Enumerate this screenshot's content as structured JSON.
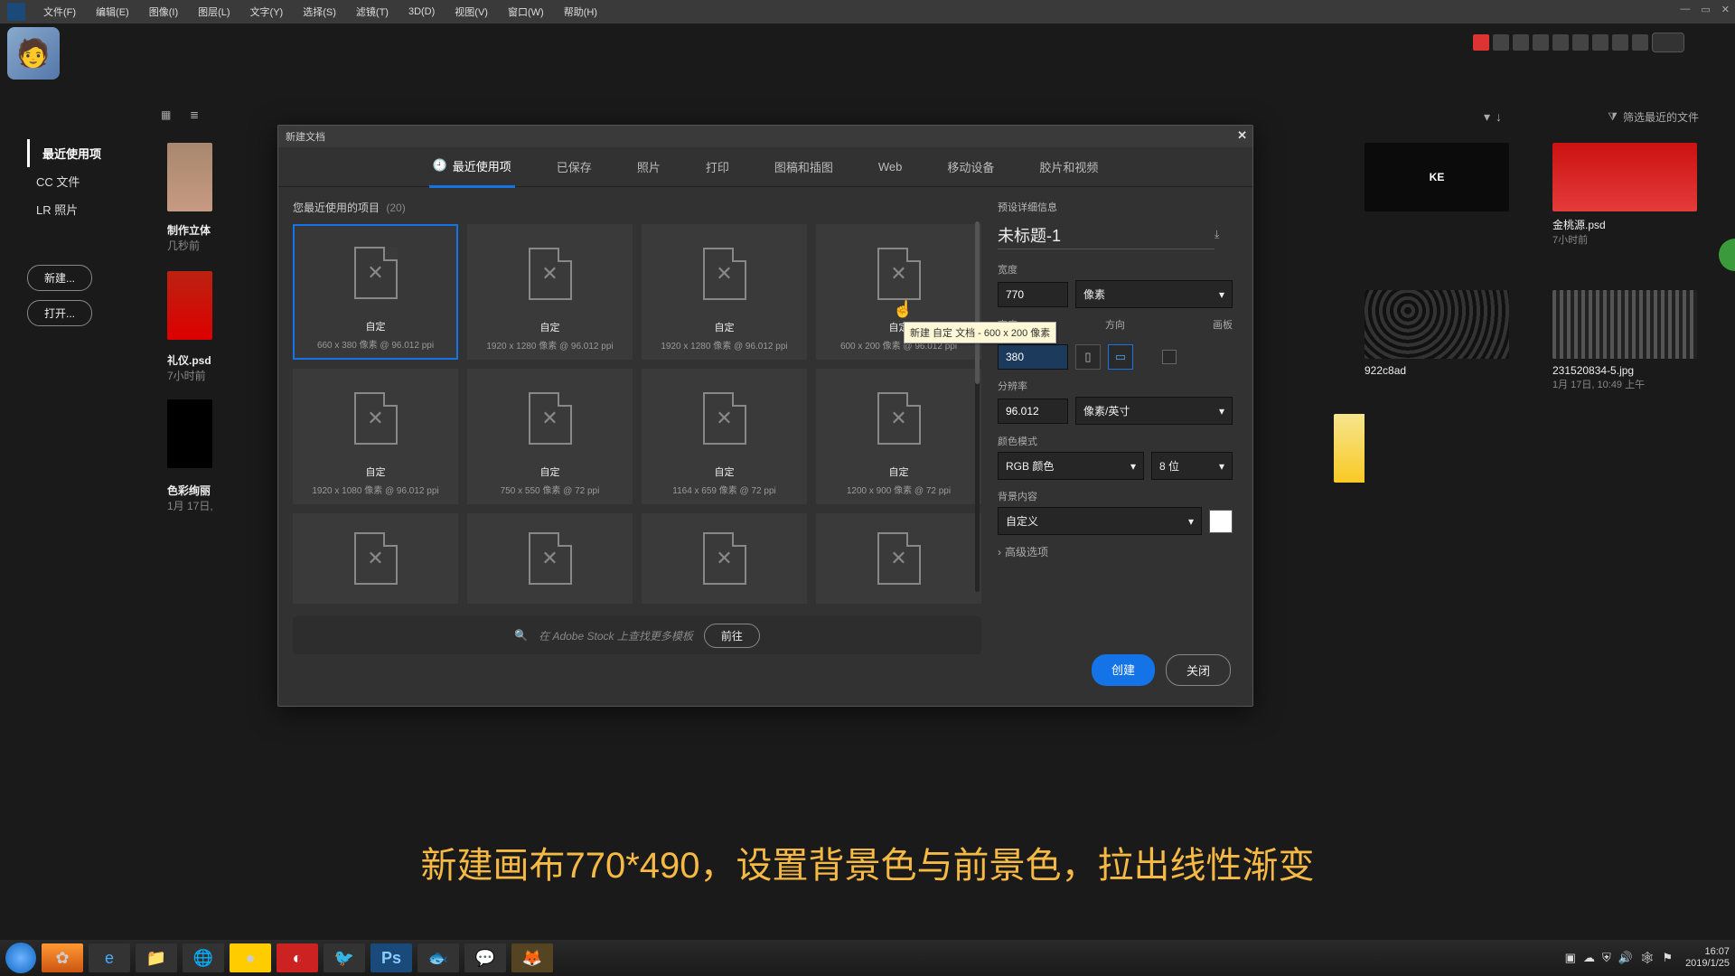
{
  "menubar": {
    "items": [
      "文件(F)",
      "编辑(E)",
      "图像(I)",
      "图层(L)",
      "文字(Y)",
      "选择(S)",
      "滤镜(T)",
      "3D(D)",
      "视图(V)",
      "窗口(W)",
      "帮助(H)"
    ]
  },
  "browse": {
    "filter_label": "筛选最近的文件",
    "sort_arrow": "↓"
  },
  "leftnav": {
    "items": [
      {
        "label": "最近使用项",
        "active": true
      },
      {
        "label": "CC 文件",
        "active": false
      },
      {
        "label": "LR 照片",
        "active": false
      }
    ],
    "new_btn": "新建...",
    "open_btn": "打开..."
  },
  "thumbs_left": [
    {
      "title": "制作立体",
      "sub": "几秒前"
    },
    {
      "title": "礼仪.psd",
      "sub": "7小时前"
    },
    {
      "title": "色彩绚丽",
      "sub": "1月 17日,"
    }
  ],
  "right_cards": [
    {
      "title": "",
      "sub": "",
      "imgtext": "KE"
    },
    {
      "title": "金桃源.psd",
      "sub": "7小时前"
    },
    {
      "title": "",
      "sub": ""
    },
    {
      "title": "922c8ad",
      "sub": ""
    },
    {
      "title": "231520834-5.jpg",
      "sub": "1月 17日, 10:49 上午"
    },
    {
      "title": "",
      "sub": ""
    }
  ],
  "dialog": {
    "title": "新建文档",
    "tabs": [
      "最近使用项",
      "已保存",
      "照片",
      "打印",
      "图稿和插图",
      "Web",
      "移动设备",
      "胶片和视频"
    ],
    "active_tab": 0,
    "list_header": "您最近使用的项目",
    "list_count": "(20)",
    "templates": [
      {
        "name": "自定",
        "size": "660 x 380 像素 @ 96.012 ppi",
        "selected": true
      },
      {
        "name": "自定",
        "size": "1920 x 1280 像素 @ 96.012 ppi"
      },
      {
        "name": "自定",
        "size": "1920 x 1280 像素 @ 96.012 ppi"
      },
      {
        "name": "自定",
        "size": "600 x 200 像素 @ 96.012 ppi"
      },
      {
        "name": "自定",
        "size": "1920 x 1080 像素 @ 96.012 ppi"
      },
      {
        "name": "自定",
        "size": "750 x 550 像素 @ 72 ppi"
      },
      {
        "name": "自定",
        "size": "1164 x 659 像素 @ 72 ppi"
      },
      {
        "name": "自定",
        "size": "1200 x 900 像素 @ 72 ppi"
      }
    ],
    "search_placeholder": "在 Adobe Stock 上查找更多模板",
    "go_btn": "前往",
    "details": {
      "header": "预设详细信息",
      "doc_title": "未标题-1",
      "width_label": "宽度",
      "width_value": "770",
      "width_unit": "像素",
      "height_label": "高度",
      "height_value": "380",
      "orientation_label": "方向",
      "artboard_label": "画板",
      "resolution_label": "分辨率",
      "resolution_value": "96.012",
      "resolution_unit": "像素/英寸",
      "color_mode_label": "颜色模式",
      "color_mode": "RGB 颜色",
      "bit_depth": "8 位",
      "background_label": "背景内容",
      "background": "自定义",
      "advanced": "高级选项"
    },
    "create_btn": "创建",
    "close_btn": "关闭"
  },
  "tooltip": "新建 自定 文档 - 600 x 200 像素",
  "caption": "新建画布770*490，设置背景色与前景色，拉出线性渐变",
  "taskbar": {
    "time": "16:07",
    "date": "2019/1/25"
  }
}
